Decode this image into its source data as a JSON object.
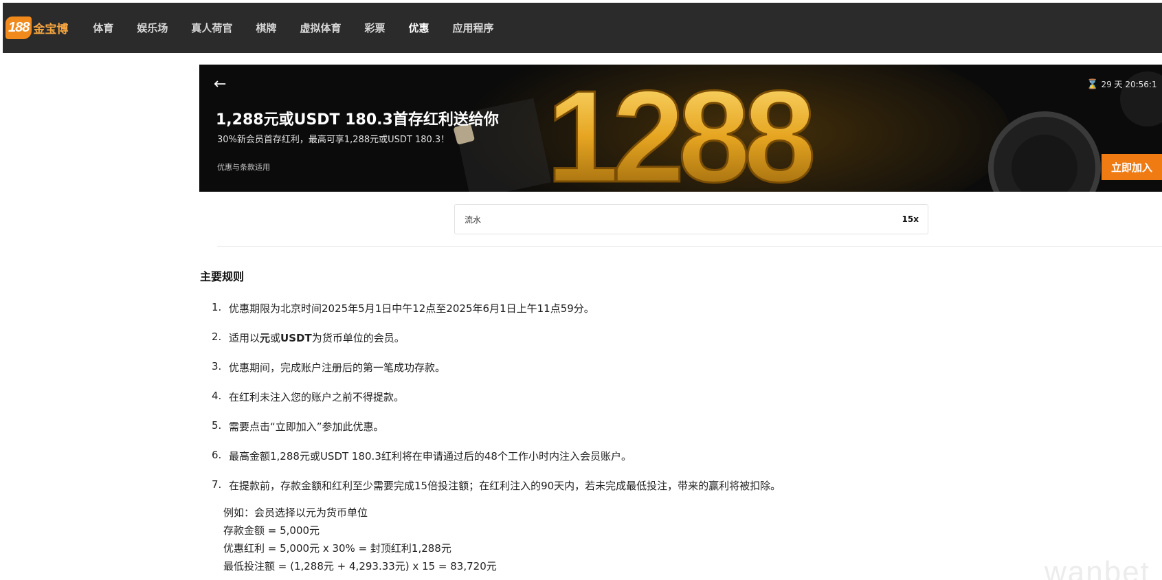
{
  "nav": {
    "logo_badge": "188",
    "logo_text": "金宝博",
    "items": [
      {
        "label": "体育"
      },
      {
        "label": "娱乐场"
      },
      {
        "label": "真人荷官"
      },
      {
        "label": "棋牌"
      },
      {
        "label": "虚拟体育"
      },
      {
        "label": "彩票"
      },
      {
        "label": "优惠",
        "active": true
      },
      {
        "label": "应用程序"
      }
    ]
  },
  "banner": {
    "back_icon": "arrow-left-icon",
    "title": "1,288元或USDT 180.3首存红利送给你",
    "subtitle": "30%新会员首存红利，最高可享1,288元或USDT 180.3！",
    "terms": "优惠与条款适用",
    "art_text": "1288",
    "countdown_icon": "hourglass-icon",
    "countdown": "29 天 20:56:1",
    "join_label": "立即加入",
    "accent": "#f07b12"
  },
  "rollover": {
    "label": "流水",
    "value": "15x"
  },
  "rules": {
    "title": "主要规则",
    "items": [
      {
        "num": "1.",
        "text": "优惠期限为北京时间2025年5月1日中午12点至2025年6月1日上午11点59分。"
      },
      {
        "num": "2.",
        "pre": "适用以",
        "b1": "元",
        "mid": "或",
        "b2": "USDT",
        "post": "为货币单位的会员。"
      },
      {
        "num": "3.",
        "text": "优惠期间，完成账户注册后的第一笔成功存款。"
      },
      {
        "num": "4.",
        "text": "在红利未注入您的账户之前不得提款。"
      },
      {
        "num": "5.",
        "text": "需要点击“立即加入”参加此优惠。"
      },
      {
        "num": "6.",
        "text": "最高金额1,288元或USDT 180.3红利将在申请通过后的48个工作小时内注入会员账户。"
      },
      {
        "num": "7.",
        "text": "在提款前，存款金额和红利至少需要完成15倍投注额；在红利注入的90天内，若未完成最低投注，带来的赢利将被扣除。"
      }
    ],
    "example": [
      "例如：会员选择以元为货币单位",
      "存款金额 = 5,000元",
      "优惠红利 = 5,000元 x 30% = 封顶红利1,288元",
      "最低投注额 = (1,288元 + 4,293.33元) x 15 = 83,720元"
    ]
  },
  "watermark": "wanbet"
}
